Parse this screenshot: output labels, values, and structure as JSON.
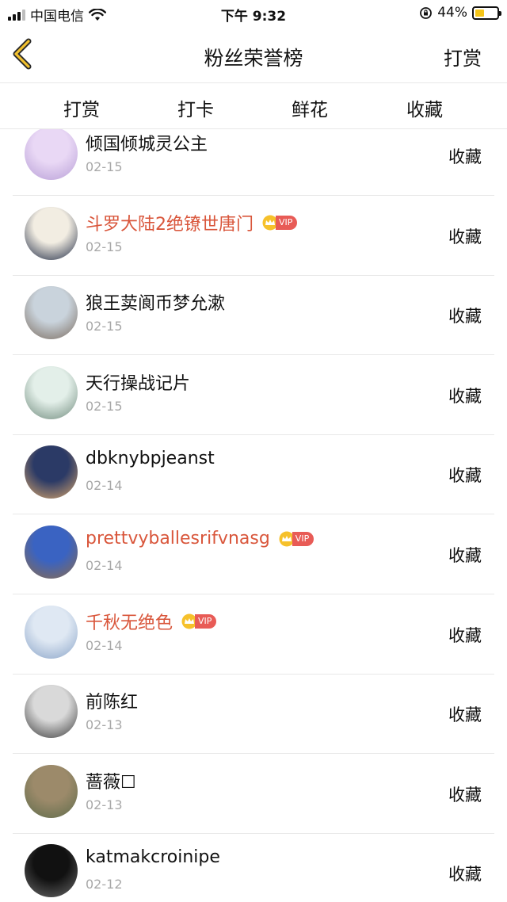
{
  "status_bar": {
    "carrier": "中国电信",
    "time": "下午 9:32",
    "battery": "44%",
    "battery_level": 0.44
  },
  "nav": {
    "title": "粉丝荣誉榜",
    "right_label": "打赏",
    "back_icon": "chevron-left-icon"
  },
  "tabs": [
    {
      "label": "打赏",
      "active": false
    },
    {
      "label": "打卡",
      "active": false
    },
    {
      "label": "鲜花",
      "active": false
    },
    {
      "label": "收藏",
      "active": true
    }
  ],
  "rows": [
    {
      "name": "倾国倾城灵公主",
      "date": "02-15",
      "vip": false,
      "action": "收藏",
      "avatar_colors": [
        "#e9d8f5",
        "#b79ed6"
      ]
    },
    {
      "name": "斗罗大陆2绝镣世唐门",
      "date": "02-15",
      "vip": true,
      "vip_label": "VIP",
      "action": "收藏",
      "avatar_colors": [
        "#f2ede2",
        "#1f2a44"
      ]
    },
    {
      "name": "狼王荬阆币梦允漱",
      "date": "02-15",
      "vip": false,
      "action": "收藏",
      "avatar_colors": [
        "#c9d3dc",
        "#7a6b5e"
      ]
    },
    {
      "name": "天行操战记片",
      "date": "02-15",
      "vip": false,
      "action": "收藏",
      "avatar_colors": [
        "#e3efe9",
        "#6f8a7c"
      ]
    },
    {
      "name": "dbknybpjeanst",
      "date": "02-14",
      "vip": false,
      "action": "收藏",
      "avatar_colors": [
        "#2b3a66",
        "#d9a66b"
      ]
    },
    {
      "name": "prettvyballesrifvnasg",
      "date": "02-14",
      "vip": true,
      "vip_label": "VIP",
      "action": "收藏",
      "avatar_colors": [
        "#3a63c2",
        "#8c6b4a"
      ]
    },
    {
      "name": "千秋无绝色",
      "date": "02-14",
      "vip": true,
      "vip_label": "VIP",
      "action": "收藏",
      "avatar_colors": [
        "#dfe8f3",
        "#8aa4c8"
      ]
    },
    {
      "name": "前陈红",
      "date": "02-13",
      "vip": false,
      "action": "收藏",
      "avatar_colors": [
        "#d9d9d9",
        "#3a3a3a"
      ]
    },
    {
      "name": "蔷薇☐",
      "date": "02-13",
      "vip": false,
      "action": "收藏",
      "avatar_colors": [
        "#9c8a6a",
        "#5d6b4a"
      ]
    },
    {
      "name": "katmakcroinipe",
      "date": "02-12",
      "vip": false,
      "action": "收藏",
      "avatar_colors": [
        "#111111",
        "#6b6b6b"
      ]
    }
  ]
}
